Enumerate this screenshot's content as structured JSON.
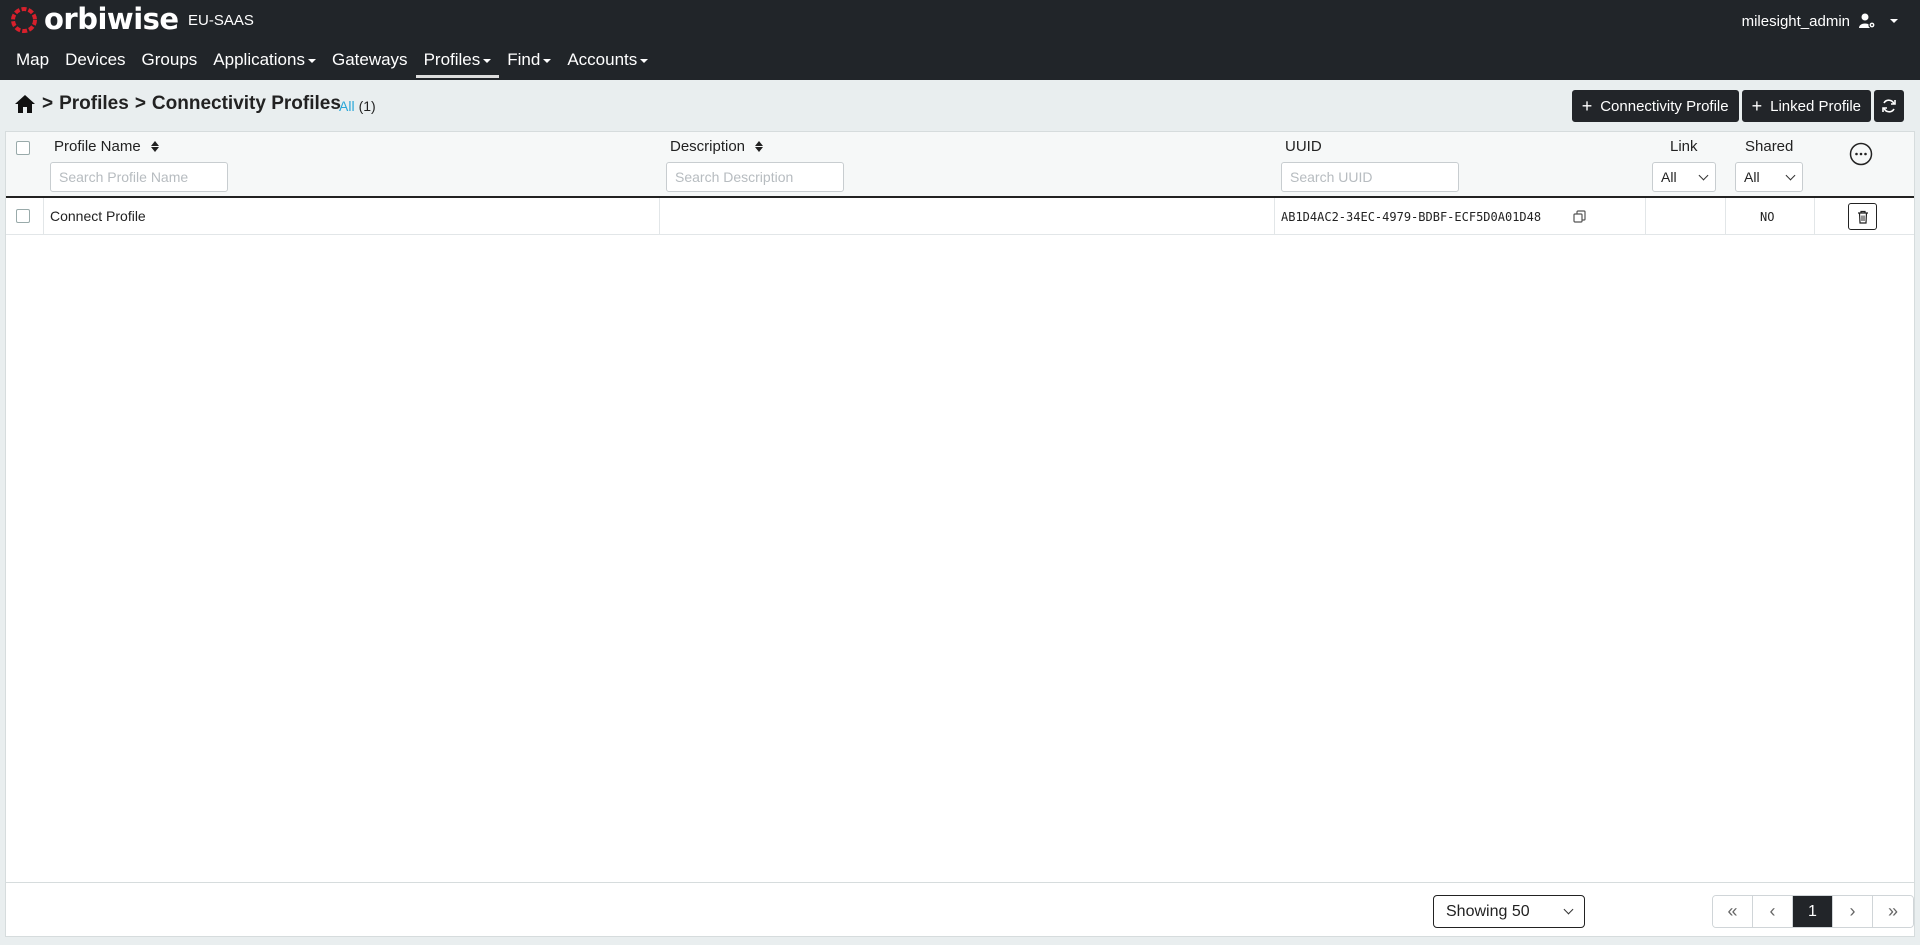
{
  "brand": {
    "name": "orbiwise",
    "environment": "EU-SAAS",
    "accent": "#d8202c"
  },
  "user": {
    "name": "milesight_admin",
    "icon": "user-gear-icon"
  },
  "nav": [
    {
      "label": "Map",
      "dropdown": false,
      "active": false
    },
    {
      "label": "Devices",
      "dropdown": false,
      "active": false
    },
    {
      "label": "Groups",
      "dropdown": false,
      "active": false
    },
    {
      "label": "Applications",
      "dropdown": true,
      "active": false
    },
    {
      "label": "Gateways",
      "dropdown": false,
      "active": false
    },
    {
      "label": "Profiles",
      "dropdown": true,
      "active": true
    },
    {
      "label": "Find",
      "dropdown": true,
      "active": false
    },
    {
      "label": "Accounts",
      "dropdown": true,
      "active": false
    }
  ],
  "breadcrumb": {
    "separator": ">",
    "items": [
      "Profiles",
      "Connectivity Profiles"
    ]
  },
  "filter_count": {
    "label": "All",
    "count": "(1)"
  },
  "actions": {
    "add_connectivity": "Connectivity Profile",
    "add_linked": "Linked Profile",
    "refresh_icon": "refresh-icon"
  },
  "table": {
    "columns": {
      "name": {
        "label": "Profile Name",
        "placeholder": "Search Profile Name"
      },
      "description": {
        "label": "Description",
        "placeholder": "Search Description"
      },
      "uuid": {
        "label": "UUID",
        "placeholder": "Search UUID"
      },
      "link": {
        "label": "Link",
        "filter": "All"
      },
      "shared": {
        "label": "Shared",
        "filter": "All"
      }
    },
    "rows": [
      {
        "name": "Connect Profile",
        "description": "",
        "uuid": "AB1D4AC2-34EC-4979-BDBF-ECF5D0A01D48",
        "link": "",
        "shared": "NO"
      }
    ]
  },
  "pagination": {
    "showing": "Showing 50",
    "current_page": "1"
  }
}
